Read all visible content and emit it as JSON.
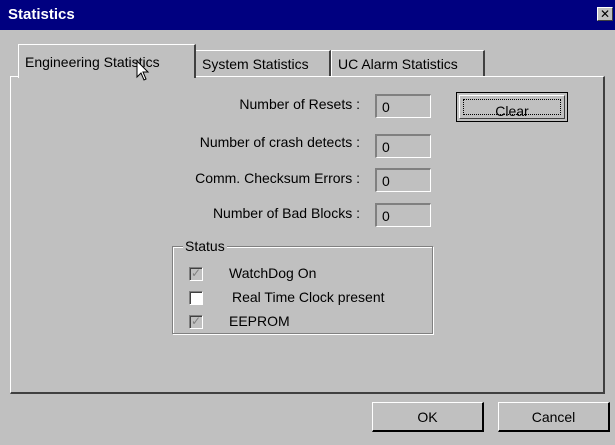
{
  "window": {
    "title": "Statistics",
    "close_glyph": "✕"
  },
  "tabs": [
    {
      "label": "Engineering Statistics",
      "active": true
    },
    {
      "label": "System Statistics",
      "active": false
    },
    {
      "label": "UC Alarm Statistics",
      "active": false
    }
  ],
  "fields": [
    {
      "label": "Number of Resets :",
      "value": "0"
    },
    {
      "label": "Number of crash detects :",
      "value": "0"
    },
    {
      "label": "Comm. Checksum Errors :",
      "value": "0"
    },
    {
      "label": "Number of Bad Blocks :",
      "value": "0"
    }
  ],
  "clear_label": "Clear",
  "status": {
    "legend": "Status",
    "items": [
      {
        "label": "WatchDog On",
        "checked": true,
        "disabled": true
      },
      {
        "label": "Real Time Clock present",
        "checked": false,
        "disabled": false
      },
      {
        "label": "EEPROM",
        "checked": true,
        "disabled": true
      }
    ]
  },
  "buttons": {
    "ok": "OK",
    "cancel": "Cancel"
  }
}
